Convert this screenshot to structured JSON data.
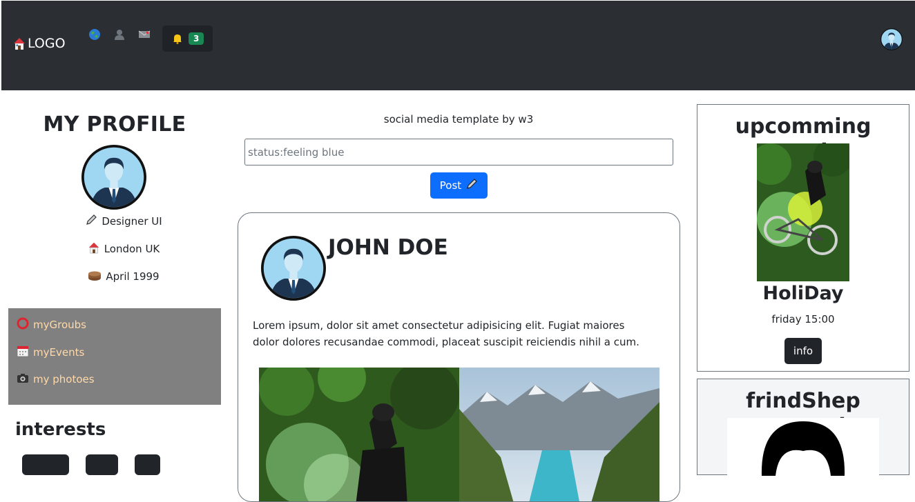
{
  "navbar": {
    "logo_label": "LOGO",
    "icons": [
      "home-icon",
      "globe-icon",
      "user-icon",
      "mail-icon",
      "bell-icon"
    ],
    "notifications_count": "3"
  },
  "profile": {
    "title": "MY PROFILE",
    "job": "Designer UI",
    "location": "London UK",
    "birthday": "April 1999"
  },
  "menu": {
    "items": [
      {
        "label": "myGroubs",
        "icon": "circle-icon"
      },
      {
        "label": "myEvents",
        "icon": "calendar-icon"
      },
      {
        "label": "my photoes",
        "icon": "camera-icon"
      }
    ]
  },
  "interests": {
    "title": "interests"
  },
  "composer": {
    "caption": "social media template by w3",
    "placeholder": "status:feeling blue",
    "post_label": "Post"
  },
  "post": {
    "author": "JOHN DOE",
    "text": "Lorem ipsum, dolor sit amet consectetur adipisicing elit. Fugiat maiores dolor dolores recusandae commodi, placeat suscipit reiciendis nihil a cum."
  },
  "events": {
    "title": "upcomming events",
    "name": "HoliDay",
    "time": "friday 15:00",
    "info_label": "info"
  },
  "friend_request": {
    "title": "frindShep request"
  },
  "colors": {
    "navbar": "#2b2f34",
    "primary": "#0d6efd",
    "badge": "#198754",
    "menu_bg": "#808080",
    "menu_text": "#ffd9a8",
    "dark_button": "#212529"
  }
}
